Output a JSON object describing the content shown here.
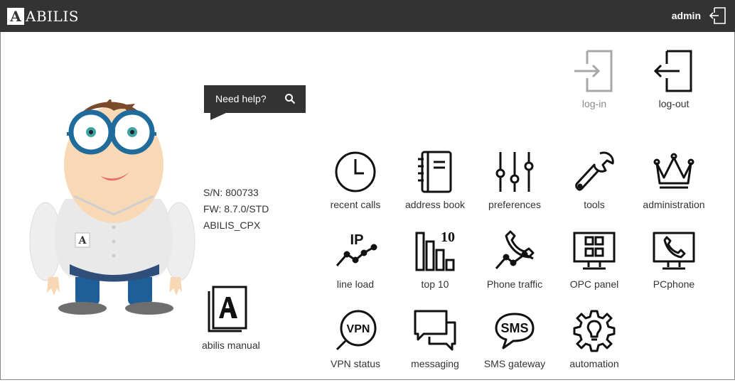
{
  "header": {
    "logo_letter": "A",
    "logo_text": "ABILIS",
    "user": "admin",
    "logout_icon": "logout-icon"
  },
  "help": {
    "label": "Need help?",
    "icon": "search-icon"
  },
  "device": {
    "sn": "S/N: 800733",
    "fw": "FW: 8.7.0/STD",
    "name": "ABILIS_CPX"
  },
  "manual": {
    "label": "abilis manual",
    "icon": "manual-book-icon"
  },
  "tiles": {
    "login": {
      "label": "log-in",
      "icon": "login-icon",
      "enabled": false
    },
    "logout": {
      "label": "log-out",
      "icon": "logout-icon"
    },
    "recent_calls": {
      "label": "recent calls",
      "icon": "clock-icon"
    },
    "address_book": {
      "label": "address book",
      "icon": "address-book-icon"
    },
    "preferences": {
      "label": "preferences",
      "icon": "sliders-icon"
    },
    "tools": {
      "label": "tools",
      "icon": "wrench-icon"
    },
    "administration": {
      "label": "administration",
      "icon": "crown-icon"
    },
    "line_load": {
      "label": "line load",
      "icon": "ip-line-chart-icon",
      "icon_text": "IP"
    },
    "top10": {
      "label": "top 10",
      "icon": "bar-chart-icon",
      "icon_text": "10"
    },
    "phone_traffic": {
      "label": "Phone traffic",
      "icon": "phone-chart-icon"
    },
    "opc_panel": {
      "label": "OPC panel",
      "icon": "monitor-grid-icon"
    },
    "pcphone": {
      "label": "PCphone",
      "icon": "monitor-phone-icon"
    },
    "vpn_status": {
      "label": "VPN status",
      "icon": "vpn-magnifier-icon",
      "icon_text": "VPN"
    },
    "messaging": {
      "label": "messaging",
      "icon": "chat-bubbles-icon"
    },
    "sms_gateway": {
      "label": "SMS gateway",
      "icon": "sms-bubble-icon",
      "icon_text": "SMS"
    },
    "automation": {
      "label": "automation",
      "icon": "gear-bulb-icon"
    }
  }
}
